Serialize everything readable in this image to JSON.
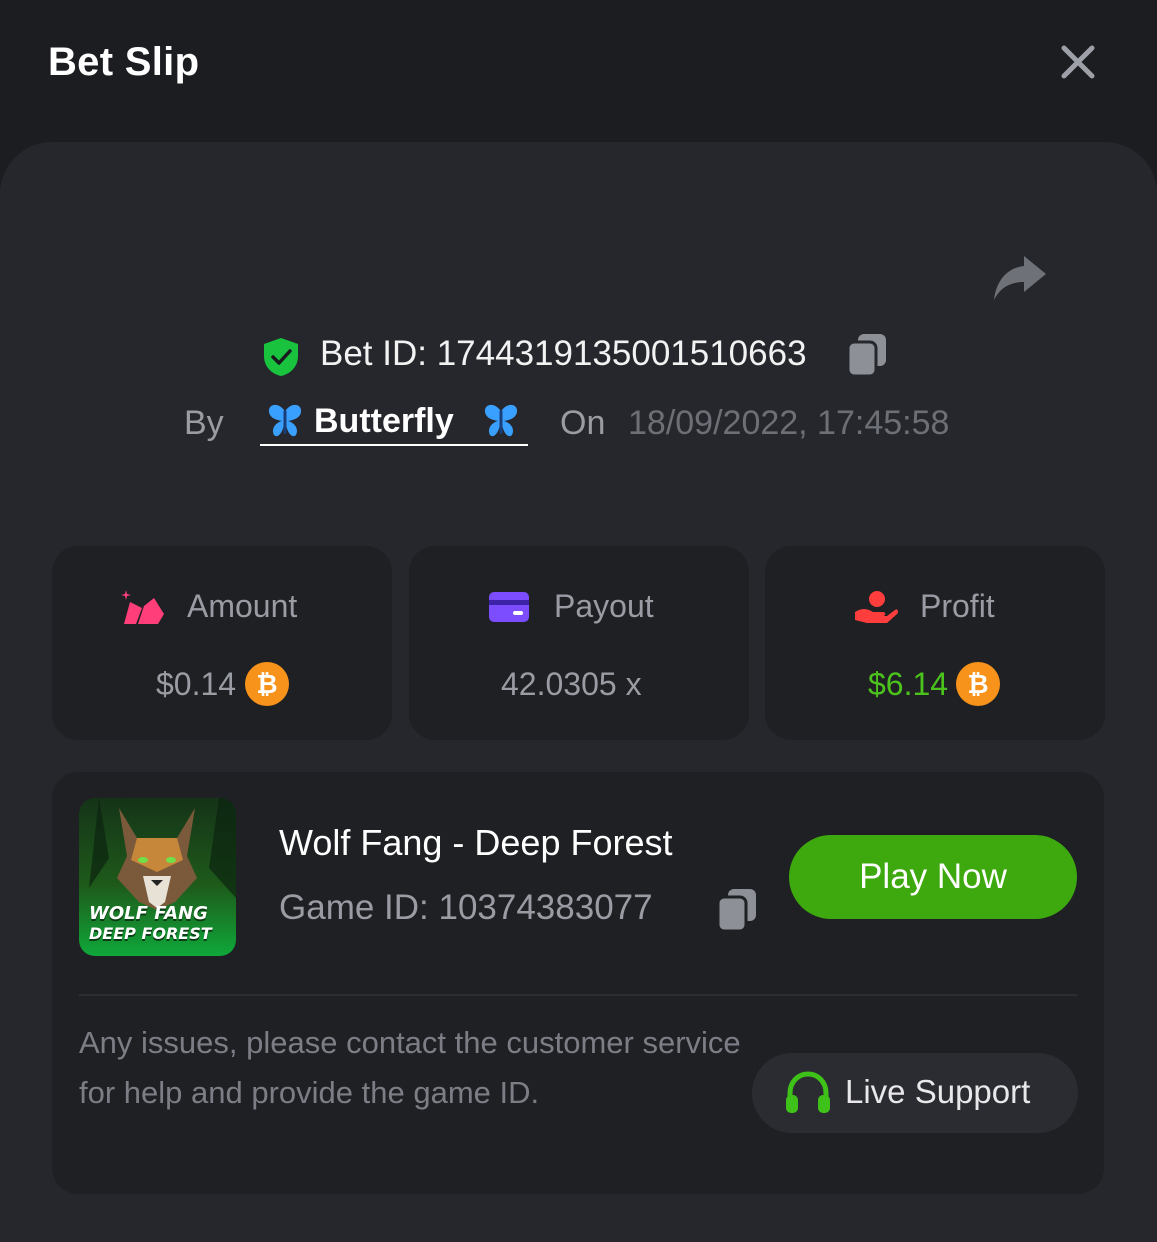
{
  "header": {
    "title": "Bet Slip"
  },
  "bet": {
    "id_text": "Bet ID: 1744319135001510663",
    "by_label": "By",
    "username": "Butterfly",
    "on_label": "On",
    "date": "18/09/2022, 17:45:58"
  },
  "stats": {
    "amount": {
      "label": "Amount",
      "value": "$0.14"
    },
    "payout": {
      "label": "Payout",
      "value": "42.0305 x"
    },
    "profit": {
      "label": "Profit",
      "value": "$6.14"
    }
  },
  "game": {
    "name": "Wolf Fang - Deep Forest",
    "id_text": "Game ID: 10374383077",
    "thumb_title_1": "WOLF FANG",
    "thumb_title_2": "DEEP FOREST",
    "play_label": "Play Now"
  },
  "help": {
    "text": "Any issues, please contact the customer service for help and provide the game ID.",
    "support_label": "Live Support"
  },
  "colors": {
    "background": "#1c1d21",
    "panel": "#26272c",
    "card": "#1f2024",
    "accent_green": "#3ea90f",
    "profit_green": "#4cc21c",
    "bitcoin_orange": "#f7931a",
    "shield_green": "#19c33e"
  },
  "icons": {
    "close": "close-icon",
    "share": "share-icon",
    "verified": "shield-check-icon",
    "copy": "copy-icon",
    "user_badge": "butterfly-icon",
    "amount": "amount-icon",
    "payout": "card-icon",
    "profit": "profit-hand-icon",
    "currency": "bitcoin-icon",
    "support": "headphones-icon"
  }
}
